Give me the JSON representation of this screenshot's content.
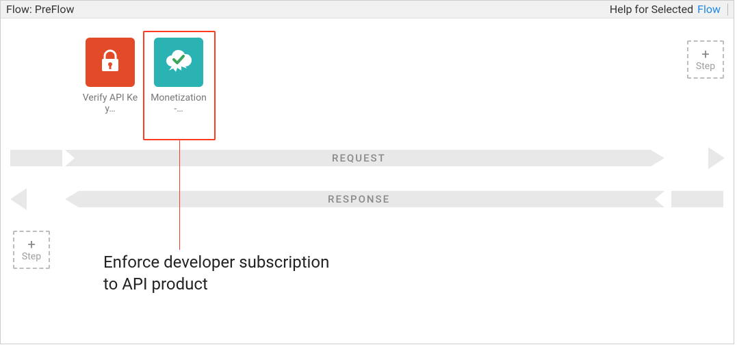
{
  "header": {
    "title": "Flow: PreFlow",
    "help_label": "Help for Selected",
    "flow_link": "Flow"
  },
  "policies": [
    {
      "label": "Verify API Key…",
      "icon": "lock-icon",
      "selected": false
    },
    {
      "label": "Monetization-…",
      "icon": "cloud-check-icon",
      "selected": true
    }
  ],
  "lanes": {
    "request": "REQUEST",
    "response": "RESPONSE"
  },
  "addstep": {
    "plus": "+",
    "label": "Step"
  },
  "annotation": {
    "text_line1": "Enforce developer subscription",
    "text_line2": "to API product"
  }
}
